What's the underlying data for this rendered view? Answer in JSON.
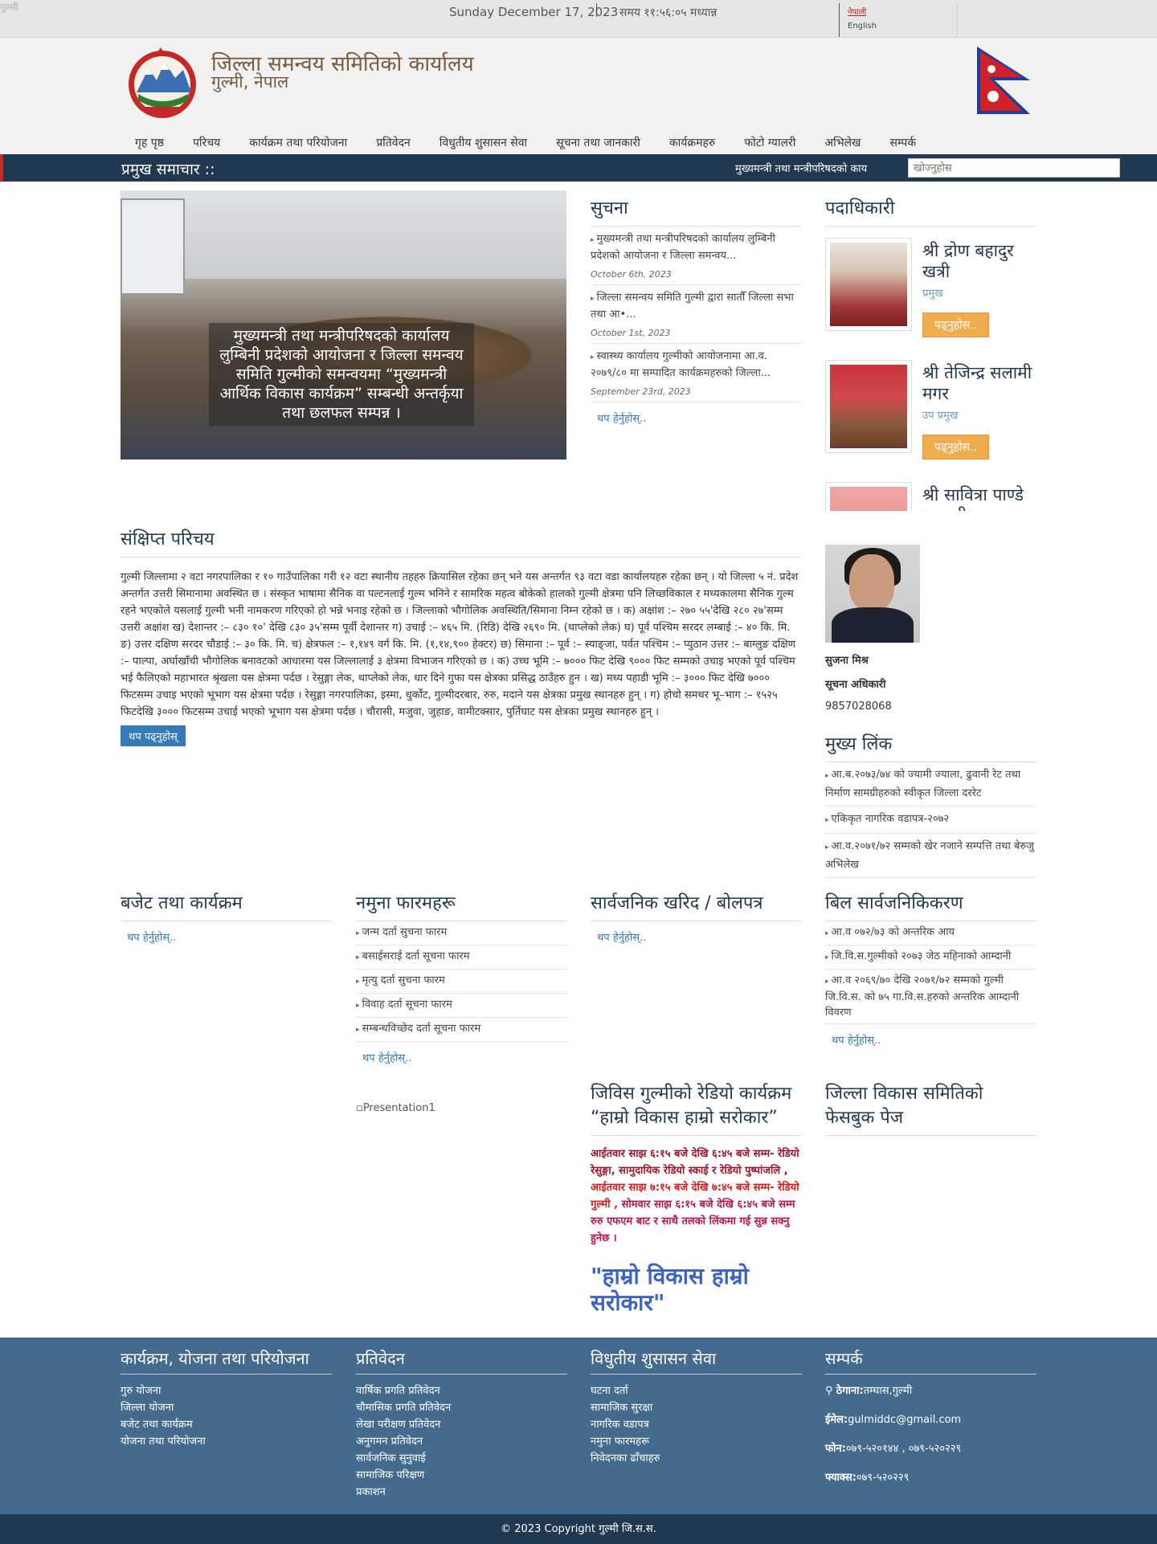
{
  "topbar": {
    "broken_img_alt": "गुल्मी",
    "date": "Sunday December 17, 2023",
    "time": "समय ११:५६:०५ मध्यान्न",
    "lang_nepali": "नेपाली",
    "lang_english": "English"
  },
  "header": {
    "title": "जिल्ला समन्वय समितिको कार्यालय",
    "subtitle": "गुल्मी, नेपाल"
  },
  "nav": [
    "गृह पृष्ठ",
    "परिचय",
    "कार्यक्रम तथा परियोजना",
    "प्रतिवेदन",
    "विधुतीय शुसासन सेवा",
    "सूचना तथा जानकारी",
    "कार्यक्रमहरु",
    "फोटो ग्यालरी",
    "अभिलेख",
    "सम्पर्क"
  ],
  "newsbar": {
    "label": "प्रमुख समाचार ::",
    "ticker": "मुख्यमन्त्री तथा मन्त्रीपरिषदको काय",
    "search_placeholder": "खोज्नुहोस"
  },
  "slide": {
    "caption": "मुख्यमन्त्री तथा मन्त्रीपरिषदको कार्यालय लुम्बिनी प्रदेशको आयोजना र जिल्ला समन्वय समिति गुल्मीको समन्वयमा “मुख्यमन्त्री आर्थिक विकास कार्यक्रम” सम्बन्धी अन्तर्कृया तथा छलफल सम्पन्न ।"
  },
  "notice": {
    "title": "सुचना",
    "items": [
      {
        "text": "मुख्यमन्त्री तथा मन्त्रीपरिषदको कार्यालय लुम्बिनी प्रदेशको आयोजना र जिल्ला समन्वय...",
        "date": "October 6th, 2023"
      },
      {
        "text": "जिल्ला समन्वय समिति गुल्मी द्वारा सातौँ जिल्ला सभा तथा आ•...",
        "date": "October 1st, 2023"
      },
      {
        "text": "स्वास्थ्य कार्यालय गुल्मीको आयोजनामा आ.व. २०७९/८० मा सम्पादित कार्यक्रमहरुको जिल्ला...",
        "date": "September 23rd, 2023"
      }
    ],
    "more": "थप हेर्नुहोस्.."
  },
  "officials": {
    "title": "पदाधिकारी",
    "people": [
      {
        "name": "श्री द्रोण बहादुर खत्री",
        "role": "प्रमुख",
        "button": "पढ्नुहोस.."
      },
      {
        "name": "श्री तेजिन्द्र सलामी मगर",
        "role": "उप प्रमुख",
        "button": "पढ्नुहोस.."
      },
      {
        "name": "श्री सावित्रा पाण्डे भण्डारी",
        "role": "",
        "button": ""
      }
    ]
  },
  "intro": {
    "title": "संक्षिप्त परिचय",
    "text": "गुल्मी जिल्लामा २ वटा नगरपालिका र १० गाउँपालिका गरी १२ वटा स्थानीय तहहरु क्रियासिल रहेका छन् भने यस अन्तर्गत ९३ वटा वडा कार्यालयहरु रहेका छन् । यो जिल्ला ५ नं. प्रदेश अन्तर्गत उत्तरी सिमानामा अवस्थित छ । संस्कृत भाषामा सैनिक वा पल्टनलाई गुल्म भनिने र सामरिक महत्व बोकेको हालको गुल्मी क्षेत्रमा पनि लिच्छविकाल र मध्यकालमा सैनिक गुल्म रहने भएकोले यसलाई गुल्मी भनी नामकरण गरिएको हो भन्ने भनाइ रहेको छ । जिल्लाको भौगोलिक अवस्थिति/सिमाना निम्न रहेको छ । क) अक्षांश :– २७० ५५'देखि २८० २७'सम्म उत्तरी अक्षांश ख) देशान्तर :– ८३० १०' देखि ८३० ३५'सम्म पूर्वी देशान्तर ग) उचाई :– ४६५ मि. (रिडि) देखि २६९० मि. (थाप्लेको लेक) घ) पूर्व पश्चिम सरदर लम्बाई :– ४० कि. मि. ङ) उत्तर दक्षिण सरदर चौडाई :– ३० कि. मि. च) क्षेत्रफल :– १,१४९ वर्ग कि. मि. (१,१४,९०० हेक्टर) छ) सिमाना :– पूर्व :– स्याङ्जा, पर्वत पश्चिम :– प्युठान उत्तर :– बाग्लुङ दक्षिण :– पाल्पा, अर्घाखाँची भौगोलिक बनावटको आधारमा यस जिल्लालाई ३ क्षेत्रमा विभाजन गरिएको छ । क) उच्च भूमि :– ७००० फिट देखि ९००० फिट सम्मको उचाइ भएको पूर्व पश्चिम भई फैलिएको महाभारत श्रृंखला यस क्षेत्रमा पर्दछ । रेसुङ्गा लेक, थाप्लेको लेक, धार दिने गुफा यस क्षेत्रका प्रसिद्ध ठाउँहरु हुन । ख) मध्य पहाडी भूमि :– ३००० फिट देखि ७००० फिटसम्म उचाइ भएको भूभाग यस क्षेत्रमा पर्दछ । रेसुङ्गा नगरपालिका, इस्मा, धुर्कोट, गुल्मीदरबार, रुरु, मदाने यस क्षेत्रका प्रमुख स्थानहरु हुन् । ग) होचो समथर भू–भाग :– १५२५ फिटदेखि ३००० फिटसम्म उचाई भएको भूभाग यस क्षेत्रमा पर्दछ । चौरासी, मजुवा, जुहाङ, वामीटक्सार, पुर्तिघाट यस क्षेत्रका प्रमुख स्थानहरु हुन् ।",
    "button": "थप पढ्नुहोस्"
  },
  "info_officer": {
    "name": "सुजना मिश्र",
    "title": "सूचना अधिकारी",
    "phone": "9857028068"
  },
  "main_links": {
    "title": "मुख्य लिंक",
    "items": [
      "आ.ब.२०७३/७४ को ज्यामी ज्याला, ढुवानी रेट तथा निर्माण सामग्रीहरुको स्वीकृत जिल्ला दररेट",
      "एकिकृत नागरिक वडापत्र-२०७२",
      "आ.व.२०७१/७२ सम्मको खेर नजाने सम्पत्ति तथा बेरुजु अभिलेख"
    ]
  },
  "budget": {
    "title": "बजेट तथा कार्यक्रम",
    "more": "थप हेर्नुहोस्.."
  },
  "forms": {
    "title": "नमुना फारमहरू",
    "items": [
      "जन्म दर्ता सुचना फारम",
      "बसाईसराई दर्ता सूचना फारम",
      "मृत्यु दर्ता सुचना फारम",
      "विवाह दर्ता सूचना फारम",
      "सम्बन्धविच्छेद दर्ता सूचना फारम"
    ],
    "more": "थप हेर्नुहोस्.."
  },
  "procurement": {
    "title": "सार्वजनिक खरिद / बोलपत्र",
    "more": "थप हेर्नुहोस्.."
  },
  "bills": {
    "title": "बिल सार्वजनिकिकरण",
    "items": [
      "आ.व ०७२/७३ को अन्तरिक आय",
      "जि.वि.स.गुल्मीको २०७३ जेठ महिनाको आम्दानी",
      "आ.व २०६९/७० देखि २०७१/७२ सम्मको गुल्मी जि.वि.स. को ७५ गा.वि.स.हरुको अन्तरिक आम्दानी विवरण"
    ],
    "more": "थप हेर्नुहोस्.."
  },
  "presentation_alt": "Presentation1",
  "radio": {
    "title": "जिविस गुल्मीको रेडियो कार्यक्रम “हाम्रो विकास हाम्रो सरोकार”",
    "schedule1": "आईतवार साझ ६:१५ बजे  देखि ६:४५ बजे सम्म- रेडियो रेसुङ्गा, सामुदायिक रेडियो स्काई र रेडियो पुष्पांजलि ,",
    "schedule2": " आईतवार साझ ७:१५ बजे  देखि ७:४५ बजे सम्म- रेडियो गुल्मी ,",
    "schedule3": " सोमवार साझ ६:१५ बजे  देखि ६:४५ बजे सम्म रुरु एफएम बाट र साथै तलको लिंकमा गई सुन्न सक्नु हुनेछ ।",
    "big": "\"हाम्रो विकास हाम्रो सरोकार\"",
    "color_dark_red": "#a0142d",
    "color_red": "#d81b1b",
    "color_pink": "#b8184f"
  },
  "facebook": {
    "title": "जिल्ला विकास समितिको फेसबुक पेज"
  },
  "footer": {
    "programs": {
      "title": "कार्यक्रम, योजना तथा परियोजना",
      "items": [
        "गुरु योजना",
        "जिल्ला योजना",
        "बजेट तथा कार्यक्रम",
        "योजना तथा परियोजना"
      ]
    },
    "reports": {
      "title": "प्रतिवेदन",
      "items": [
        "वार्षिक प्रगति प्रतिवेदन",
        "चौमासिक प्रगति प्रतिवेदन",
        "लेखा परीक्षण प्रतिवेदन",
        "अनुगमन प्रतिवेदन",
        "सार्वजनिक सुनुवाई",
        "सामाजिक परिक्षण",
        "प्रकाशन"
      ]
    },
    "egov": {
      "title": "विधुतीय शुसासन सेवा",
      "items": [
        "घटना दर्ता",
        "सामाजिक सुरक्षा",
        "नागरिक वडापत्र",
        "नमुना फारमहरू",
        "निवेदनका ढाँचाहरु"
      ]
    },
    "contact": {
      "title": "सम्पर्क",
      "address_label": "ठेगाना:",
      "address": "तम्घास,गुल्मी",
      "email_label": "ईमेल:",
      "email": "gulmiddc@gmail.com",
      "phone_label": "फोन:",
      "phone": "०७९-५२०१४४ , ०७९-५२०२२९",
      "fax_label": "फ्याक्स:",
      "fax": "०७९-५२०२२९"
    }
  },
  "copyright": "© 2023 Copyright गुल्मी जि.स.स.",
  "colors": {
    "navy": "#213950",
    "footer_blue": "#446b8e",
    "accent_blue": "#337ab7",
    "orange": "#f0ad4e",
    "title_brown": "#7a5a3c"
  }
}
